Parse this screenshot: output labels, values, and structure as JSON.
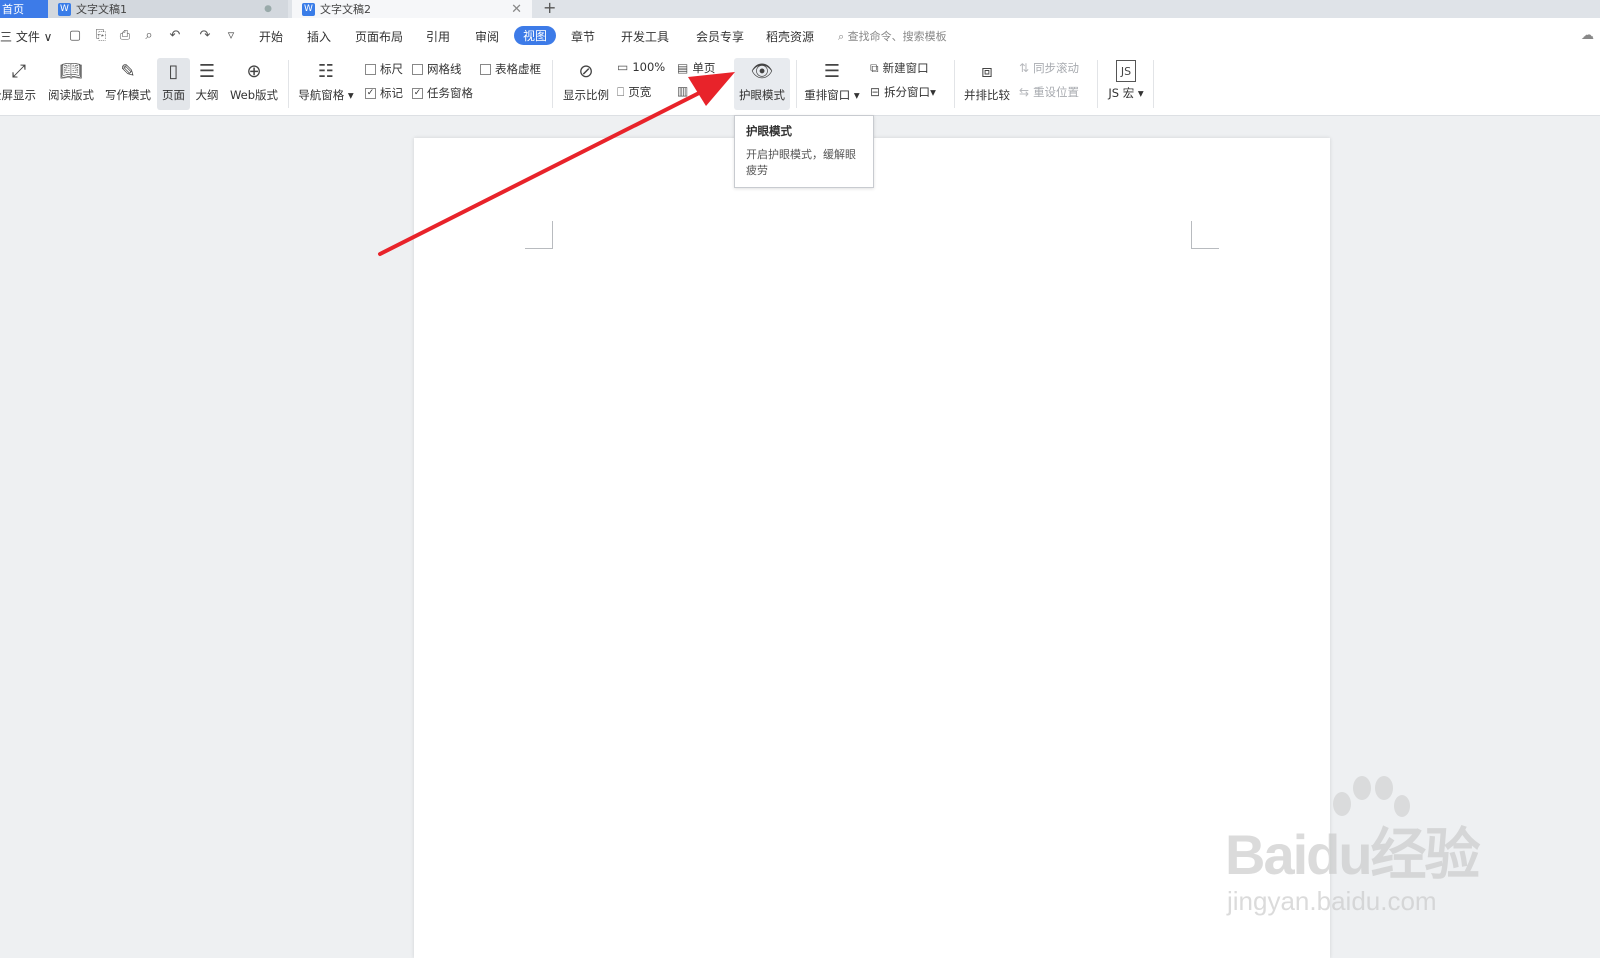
{
  "tabs": {
    "home": "首页",
    "doc1": "文字文稿1",
    "doc2": "文字文稿2",
    "new_tab": "+"
  },
  "menu": {
    "file": "三 文件 ∨",
    "tabs": [
      "开始",
      "插入",
      "页面布局",
      "引用",
      "审阅",
      "视图",
      "章节",
      "开发工具",
      "会员专享",
      "稻壳资源"
    ],
    "active_tab": "视图",
    "search_placeholder": "查找命令、搜索模板"
  },
  "ribbon": {
    "fullscreen": "全屏显示",
    "reading": "阅读版式",
    "writing": "写作模式",
    "page": "页面",
    "outline": "大纲",
    "web": "Web版式",
    "nav_pane": "导航窗格",
    "ruler": "标尺",
    "gridlines": "网格线",
    "table_gridlines": "表格虚框",
    "marks": "标记",
    "task_pane": "任务窗格",
    "zoom": "显示比例",
    "zoom_100": "100%",
    "page_width": "页宽",
    "single_page": "单页",
    "eye_protect": "护眼模式",
    "arrange": "重排窗口",
    "new_window": "新建窗口",
    "split_window": "拆分窗口",
    "side_by_side": "并排比较",
    "sync_scroll": "同步滚动",
    "reset_position": "重设位置",
    "js_macro": "JS 宏"
  },
  "checks": {
    "ruler": false,
    "gridlines": false,
    "table_gridlines": false,
    "marks": true,
    "task_pane": true
  },
  "tooltip": {
    "title": "护眼模式",
    "description": "开启护眼模式，缓解眼疲劳"
  },
  "watermark": {
    "brand": "Baidu经验",
    "url": "jingyan.baidu.com"
  },
  "colors": {
    "accent": "#3d7be8",
    "arrow": "#e8232a"
  }
}
